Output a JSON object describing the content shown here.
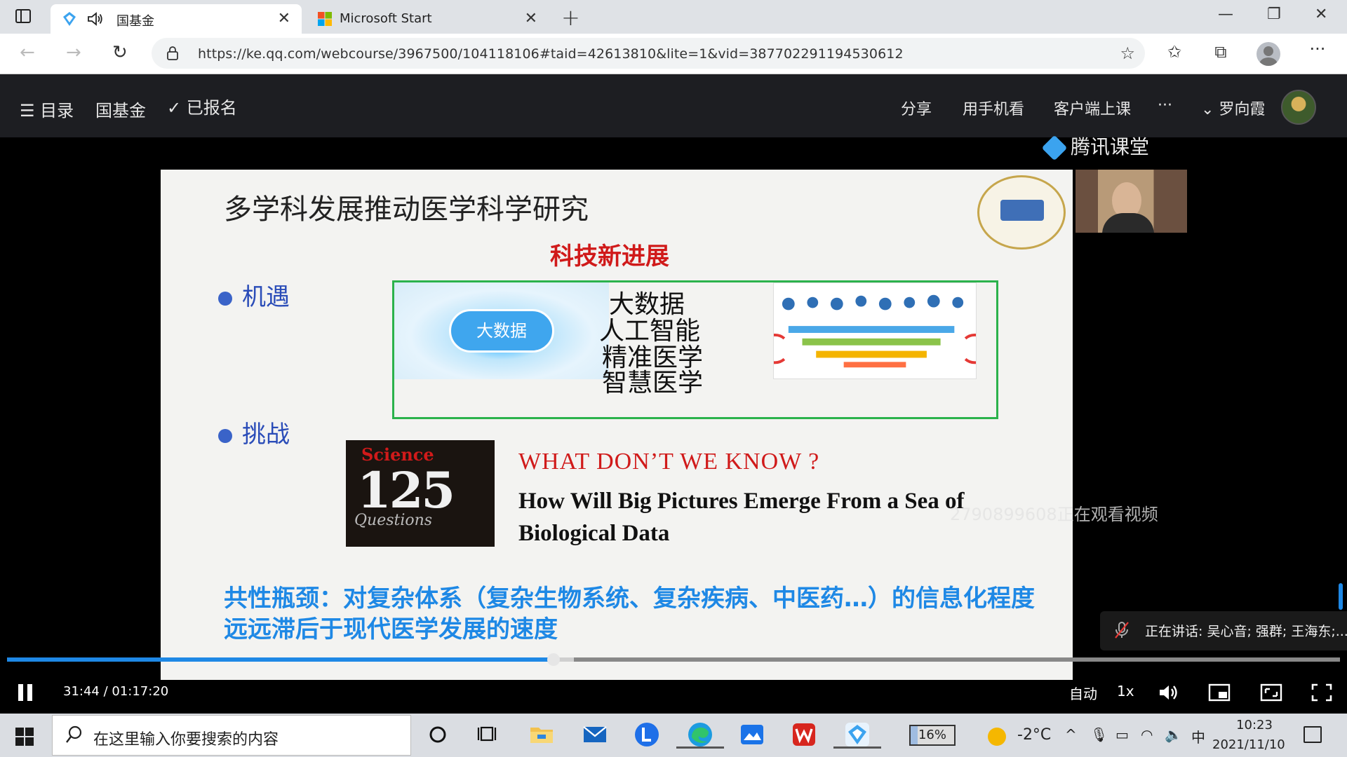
{
  "browser": {
    "tabs": [
      {
        "title": "国基金",
        "active": true,
        "audio": true,
        "favicon": "tencent-classroom-icon"
      },
      {
        "title": "Microsoft Start",
        "active": false,
        "favicon": "microsoft-logo-icon"
      }
    ],
    "url": "https://ke.qq.com/webcourse/3967500/104118106#taid=42613810&lite=1&vid=387702291194530612"
  },
  "site_header": {
    "menu_label": "目录",
    "course_title": "国基金",
    "enrolled_label": "已报名",
    "share": "分享",
    "mobile": "用手机看",
    "client": "客户端上课",
    "more": "···",
    "username": "罗向霞"
  },
  "slide": {
    "title": "多学科发展推动医学科学研究",
    "subtitle": "科技新进展",
    "bullet_opportunity": "机遇",
    "bullet_challenge": "挑战",
    "bigdata_badge": "大数据",
    "ai_words": [
      "大数据",
      "人工智能",
      "精准医学",
      "智慧医学"
    ],
    "science_cover_title": "Science",
    "science_cover_number": "125",
    "science_cover_sub": "Questions",
    "what_dont_we_know": "WHAT  DON’T  WE  KNOW  ?",
    "how_will": "How Will Big Pictures Emerge From a Sea of Biological Data",
    "bottleneck": "共性瓶颈：对复杂体系（复杂生物系统、复杂疾病、中医药…）的信息化程度远远滞后于现代医学发展的速度"
  },
  "overlay": {
    "brand": "腾讯课堂",
    "watermark": "2790899608正在观看视频",
    "speaking": "正在讲话: 吴心音; 强群; 王海东;..."
  },
  "player": {
    "current_time": "31:44",
    "duration": "01:17:20",
    "time_display": "31:44 / 01:17:20",
    "progress_fraction": 0.41,
    "buffered_fraction": 0.425,
    "quality": "自动",
    "speed": "1x"
  },
  "taskbar": {
    "search_placeholder": "在这里输入你要搜索的内容",
    "battery": "16%",
    "battery_fraction": 0.16,
    "temperature": "-2°C",
    "ime": "中",
    "time": "10:23",
    "date": "2021/11/10"
  },
  "colors": {
    "accent": "#1e88e5",
    "slide_red": "#d01a1a",
    "slide_blue": "#2a4cb8",
    "green_frame": "#2bb24c"
  }
}
